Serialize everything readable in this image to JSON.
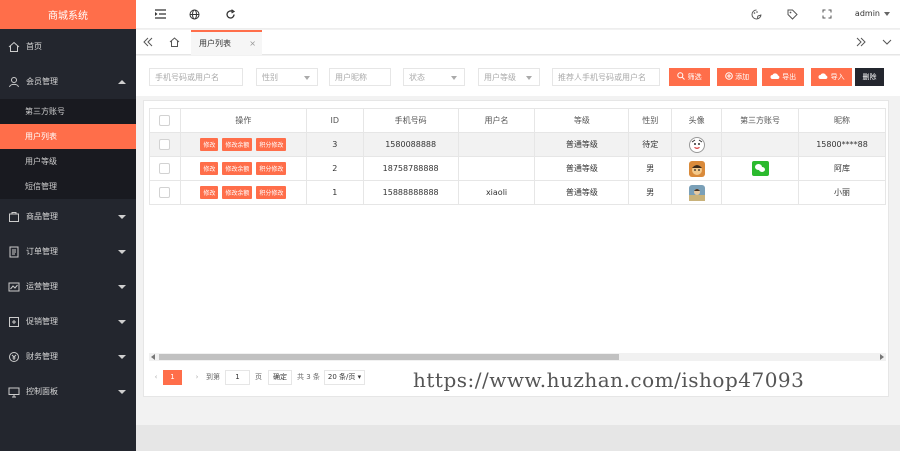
{
  "app": {
    "title": "商城系统"
  },
  "sidebar": {
    "items": [
      {
        "label": "首页",
        "icon": "home-icon"
      },
      {
        "label": "会员管理",
        "icon": "user-icon",
        "expanded": true,
        "children": [
          {
            "label": "第三方账号"
          },
          {
            "label": "用户列表",
            "active": true
          },
          {
            "label": "用户等级"
          },
          {
            "label": "短信管理"
          }
        ]
      },
      {
        "label": "商品管理",
        "icon": "goods-icon"
      },
      {
        "label": "订单管理",
        "icon": "order-icon"
      },
      {
        "label": "运营管理",
        "icon": "operation-icon"
      },
      {
        "label": "促销管理",
        "icon": "promotion-icon"
      },
      {
        "label": "财务管理",
        "icon": "finance-icon"
      },
      {
        "label": "控制面板",
        "icon": "control-panel-icon"
      }
    ]
  },
  "topbar": {
    "user": "admin"
  },
  "tabs": [
    {
      "label": "用户列表",
      "close": "×"
    }
  ],
  "filters": {
    "phone_placeholder": "手机号码或用户名",
    "gender_placeholder": "性别",
    "nickname_placeholder": "用户昵称",
    "status_placeholder": "状态",
    "level_placeholder": "用户等级",
    "referrer_placeholder": "推荐人手机号码或用户名",
    "search_label": "筛选",
    "add_label": "添加",
    "export_label": "导出",
    "import_label": "导入",
    "delete_label": "删除"
  },
  "table": {
    "headers": [
      "操作",
      "ID",
      "手机号码",
      "用户名",
      "等级",
      "性别",
      "头像",
      "第三方账号",
      "昵称"
    ],
    "action_labels": [
      "修改",
      "修改余额",
      "积分修改"
    ],
    "rows": [
      {
        "id": "3",
        "phone": "1580088888",
        "username": "",
        "level": "普通等级",
        "gender": "待定",
        "avatar": "avatar-sketch",
        "third_party": "",
        "nickname": "15800****88",
        "highlight": true
      },
      {
        "id": "2",
        "phone": "18758788888",
        "username": "",
        "level": "普通等级",
        "gender": "男",
        "avatar": "avatar-cartoon",
        "third_party": "wechat-icon",
        "nickname": "阿库",
        "highlight": false
      },
      {
        "id": "1",
        "phone": "15888888888",
        "username": "xiaoli",
        "level": "普通等级",
        "gender": "男",
        "avatar": "avatar-photo",
        "third_party": "",
        "nickname": "小丽",
        "highlight": false
      }
    ]
  },
  "pagination": {
    "current": "1",
    "goto_label": "到第",
    "goto_value": "1",
    "page_unit": "页",
    "confirm_label": "确定",
    "total_label": "共 3 条",
    "page_size": "20 条/页"
  },
  "watermark": "https://www.huzhan.com/ishop47093",
  "colors": {
    "accent": "#ff6e4a",
    "sidebar": "#23262e",
    "wechat": "#2bba2e"
  }
}
